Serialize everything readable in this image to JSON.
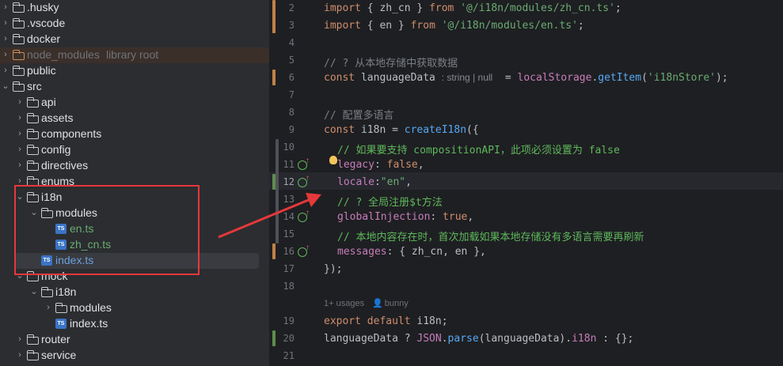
{
  "project_tree": {
    "items": [
      {
        "label": ".husky",
        "type": "folder",
        "depth": 0,
        "expanded": false
      },
      {
        "label": ".vscode",
        "type": "folder",
        "depth": 0,
        "expanded": false
      },
      {
        "label": "docker",
        "type": "folder",
        "depth": 0,
        "expanded": false
      },
      {
        "label": "node_modules",
        "type": "folder",
        "depth": 0,
        "expanded": false,
        "note": "library root",
        "excluded": true
      },
      {
        "label": "public",
        "type": "folder",
        "depth": 0,
        "expanded": false
      },
      {
        "label": "src",
        "type": "folder",
        "depth": 0,
        "expanded": true
      },
      {
        "label": "api",
        "type": "folder",
        "depth": 1,
        "expanded": false
      },
      {
        "label": "assets",
        "type": "folder",
        "depth": 1,
        "expanded": false
      },
      {
        "label": "components",
        "type": "folder",
        "depth": 1,
        "expanded": false
      },
      {
        "label": "config",
        "type": "folder",
        "depth": 1,
        "expanded": false
      },
      {
        "label": "directives",
        "type": "folder",
        "depth": 1,
        "expanded": false
      },
      {
        "label": "enums",
        "type": "folder",
        "depth": 1,
        "expanded": false
      },
      {
        "label": "i18n",
        "type": "folder",
        "depth": 1,
        "expanded": true
      },
      {
        "label": "modules",
        "type": "folder",
        "depth": 2,
        "expanded": true
      },
      {
        "label": "en.ts",
        "type": "ts",
        "depth": 3,
        "color": "green"
      },
      {
        "label": "zh_cn.ts",
        "type": "ts",
        "depth": 3,
        "color": "green"
      },
      {
        "label": "index.ts",
        "type": "ts",
        "depth": 2,
        "color": "blue",
        "selected": true
      },
      {
        "label": "mock",
        "type": "folder",
        "depth": 1,
        "expanded": true
      },
      {
        "label": "i18n",
        "type": "folder",
        "depth": 2,
        "expanded": true
      },
      {
        "label": "modules",
        "type": "folder",
        "depth": 3,
        "expanded": false
      },
      {
        "label": "index.ts",
        "type": "ts",
        "depth": 3
      },
      {
        "label": "router",
        "type": "folder",
        "depth": 1,
        "expanded": false
      },
      {
        "label": "service",
        "type": "folder",
        "depth": 1,
        "expanded": false
      }
    ]
  },
  "editor": {
    "lines": [
      {
        "n": "2"
      },
      {
        "n": "3"
      },
      {
        "n": "4"
      },
      {
        "n": "5"
      },
      {
        "n": "6"
      },
      {
        "n": "7"
      },
      {
        "n": "8"
      },
      {
        "n": "9"
      },
      {
        "n": "10"
      },
      {
        "n": "11"
      },
      {
        "n": "12"
      },
      {
        "n": "13"
      },
      {
        "n": "14"
      },
      {
        "n": "15"
      },
      {
        "n": "16"
      },
      {
        "n": "17"
      },
      {
        "n": "18"
      },
      {
        "n": "19"
      },
      {
        "n": "20"
      },
      {
        "n": "21"
      }
    ],
    "code": {
      "l2": [
        "import",
        " { ",
        "zh_cn",
        " } ",
        "from",
        " ",
        "'@/i18n/modules/zh_cn.ts'",
        ";"
      ],
      "l3": [
        "import",
        " { ",
        "en",
        " } ",
        "from",
        " ",
        "'@/i18n/modules/en.ts'",
        ";"
      ],
      "l5": "// ? 从本地存储中获取数据",
      "l6_kw": "const",
      "l6_name": " languageData ",
      "l6_hint": ": string | null",
      "l6_rest_a": "  = ",
      "l6_obj": "localStorage",
      "l6_dot": ".",
      "l6_fn": "getItem",
      "l6_arg": "'i18nStore'",
      "l6_end": ");",
      "l6_open": "(",
      "l8": "// 配置多语言",
      "l9_kw": "const",
      "l9_name": " i18n = ",
      "l9_fn": "createI18n",
      "l9_end": "({",
      "l10": "// 如果要支持 compositionAPI，此项必须设置为 false",
      "l11_prop": "legacy",
      "l11_colon": ": ",
      "l11_val": "false",
      "l11_end": ",",
      "l12_prop": "locale",
      "l12_colon": ":",
      "l12_val": "\"en\"",
      "l12_end": ",",
      "l13": "// ? 全局注册$t方法",
      "l14_prop": "globalInjection",
      "l14_colon": ": ",
      "l14_val": "true",
      "l14_end": ",",
      "l15": "// 本地内容存在时，首次加载如果本地存储没有多语言需要再刷新",
      "l16_prop": "messages",
      "l16_rest": ": { zh_cn, en },",
      "l17": "});",
      "inlay_usages": "1+ usages",
      "inlay_author": "bunny",
      "l19_kw": "export default",
      "l19_rest": " i18n;",
      "l20_a": "languageData ? ",
      "l20_json": "JSON",
      "l20_dot": ".",
      "l20_fn": "parse",
      "l20_b": "(languageData).",
      "l20_prop": "i18n",
      "l20_c": " : {};"
    }
  },
  "colors": {
    "panel_bg": "#2b2d30",
    "editor_bg": "#1e1f22",
    "annotation_red": "#e5383b"
  },
  "icons": [
    "chevron-right-icon",
    "chevron-down-icon",
    "folder-icon",
    "typescript-file-icon",
    "implements-gutter-icon",
    "lightbulb-icon",
    "user-icon"
  ]
}
